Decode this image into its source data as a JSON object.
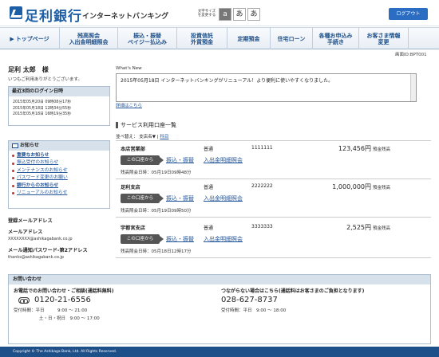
{
  "header": {
    "bank_name": "足利銀行",
    "service_name": "インターネットバンキング",
    "font_size_label": "文字サイズを変更する",
    "font_small": "a",
    "font_medium": "あ",
    "font_large": "あ",
    "logout_label": "ログアウト",
    "brand_color": "#1d5fa7"
  },
  "nav": {
    "items": [
      {
        "label": "トップページ",
        "icon": "home-icon"
      },
      {
        "label": "残高照会\n入出金明細照会"
      },
      {
        "label": "振込・振替\nペイジー払込み"
      },
      {
        "label": "投資信託\n外貨預金"
      },
      {
        "label": "定期預金"
      },
      {
        "label": "住宅ローン"
      },
      {
        "label": "各種お申込み\n手続き"
      },
      {
        "label": "お客さま情報\n変更"
      }
    ]
  },
  "screen_id": "画面ID:BPT001",
  "welcome": {
    "name": "足利 太郎　様",
    "message": "いつもご利用ありがとうございます。"
  },
  "login_history": {
    "title": "最近3回のログイン日時",
    "entries": [
      "2015年05月20日 09時08分17秒",
      "2015年05月18日 12時34分55秒",
      "2015年05月18日 16時19分35秒"
    ]
  },
  "notices": {
    "title": "お知らせ",
    "items": [
      {
        "label": "重要なお知らせ",
        "bold": true
      },
      {
        "label": "振込受付のお知らせ",
        "bold": false
      },
      {
        "label": "メンテナンスのお知らせ",
        "bold": false
      },
      {
        "label": "パスワード変更のお願い",
        "bold": false
      },
      {
        "label": "銀行からのお知らせ",
        "bold": true
      },
      {
        "label": "リニューアルのお知らせ",
        "bold": false
      }
    ]
  },
  "registered_mail": {
    "title": "登録メールアドレス",
    "mail_label": "メールアドレス",
    "mail_value": "XXXXXXXX@ashikagabank.co.jp",
    "notify_label": "メール通知パスワード-第2アドレス",
    "notify_value": "thanks@ashikagabank.co.jp"
  },
  "whats_new": {
    "label": "What's New",
    "text": "2015年05月18日 インターネットバンキングがリニューアル！より便利に使いやすくなりました。",
    "more_link": "詳細はこちら"
  },
  "service_accounts": {
    "title": "サービス利用口座一覧",
    "sort_label": "並べ替え：",
    "sort_branch": "支店名",
    "sort_sep": "|",
    "sort_date": "科目",
    "action_button": "この口座から",
    "transfer_link": "振込・振替",
    "detail_link": "入出金明細照会",
    "balance_label": "預金残高",
    "accounts": [
      {
        "branch": "本店営業部",
        "type": "普通",
        "number": "1111111",
        "balance": "123,456円",
        "time": "残高照会日時：05月19日09時48分"
      },
      {
        "branch": "足利支店",
        "type": "普通",
        "number": "2222222",
        "balance": "1,000,000円",
        "time": "残高照会日時：05月19日09時50分"
      },
      {
        "branch": "宇都宮支店",
        "type": "普通",
        "number": "3333333",
        "balance": "2,525円",
        "time": "残高照会日時：05月18日12時17分"
      }
    ]
  },
  "inquiry": {
    "title": "お問い合わせ",
    "left_head": "お電話でのお問い合わせ・ご相談(通話料無料)",
    "left_tel": "0120-21-6556",
    "left_hours1": "受付時間：平日　　　9:00 ～ 21:00",
    "left_hours2": "土・日・祝日　9:00 ～ 17:00",
    "right_head": "つながらない場合はこちら(通話料はお客さまのご負担となります)",
    "right_tel": "028-627-8737",
    "right_hours": "受付時間：平日　9:00 ～ 18:00"
  },
  "footer": {
    "copyright": "Copyright © The Ashikaga Bank, Ltd. All Rights Reserved."
  }
}
